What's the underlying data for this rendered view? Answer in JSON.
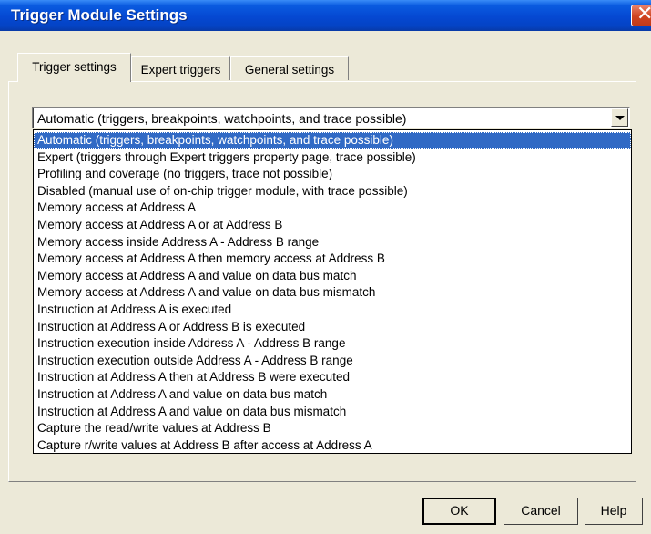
{
  "window": {
    "title": "Trigger Module Settings",
    "close_glyph": "✕"
  },
  "tabs": [
    {
      "label": "Trigger settings",
      "active": true
    },
    {
      "label": "Expert triggers",
      "active": false
    },
    {
      "label": "General settings",
      "active": false
    }
  ],
  "combo": {
    "value": "Automatic (triggers, breakpoints, watchpoints, and trace possible)",
    "options": [
      "Automatic (triggers, breakpoints, watchpoints, and trace possible)",
      "Expert (triggers through Expert triggers property page, trace possible)",
      "Profiling and coverage (no triggers, trace not possible)",
      "Disabled (manual use of on-chip trigger module, with trace possible)",
      "Memory access at Address A",
      "Memory access at Address A or at Address B",
      "Memory access inside Address A - Address B range",
      "Memory access at Address A then memory access at Address B",
      "Memory access at Address A and value on data bus match",
      "Memory access at Address A and value on data bus mismatch",
      "Instruction at Address A is executed",
      "Instruction at Address A or Address B is executed",
      "Instruction execution inside Address A - Address B range",
      "Instruction execution outside Address A - Address B range",
      "Instruction at Address A then at Address B were executed",
      "Instruction at Address A and value on data bus match",
      "Instruction at Address A and value on data bus mismatch",
      "Capture the read/write values at Address B",
      "Capture r/write values at Address B after access at Address A"
    ],
    "selected_index": 0
  },
  "buttons": {
    "ok": "OK",
    "cancel": "Cancel",
    "help": "Help"
  },
  "colors": {
    "selection": "#316ac5",
    "dialog_bg": "#ece9d8",
    "titlebar": "#0548d2"
  }
}
